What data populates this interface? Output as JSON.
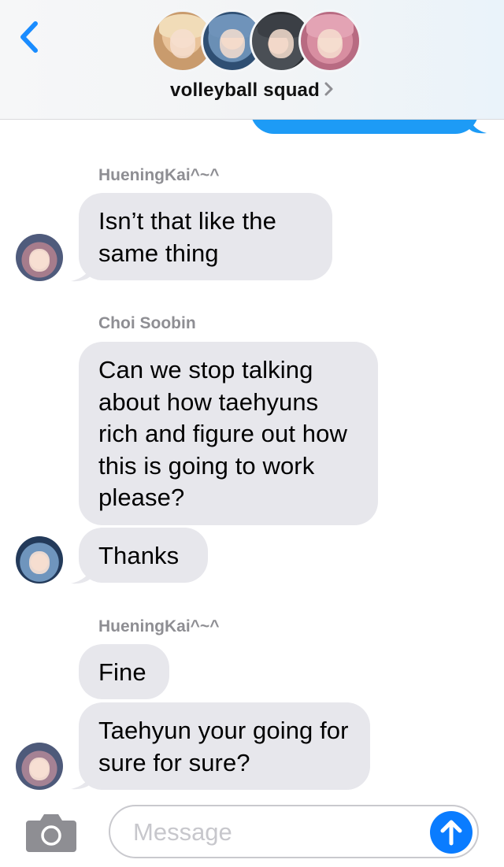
{
  "header": {
    "group_name": "volleyball squad",
    "members": [
      "member-1",
      "member-2",
      "member-3",
      "member-4"
    ]
  },
  "messages": [
    {
      "sender": "HueningKai^~^",
      "text": "Isn’t that like the same thing"
    },
    {
      "sender": "Choi Soobin",
      "text": "Can we stop talking about how taehyuns rich and figure out how this is going to work please?"
    },
    {
      "sender": "",
      "text": "Thanks"
    },
    {
      "sender": "HueningKai^~^",
      "text": "Fine"
    },
    {
      "sender": "",
      "text": "Taehyun your going for sure for sure?"
    }
  ],
  "composer": {
    "placeholder": "Message"
  },
  "colors": {
    "incoming_bubble": "#e7e7ec",
    "outgoing_bubble": "#1d9bf6",
    "accent": "#0a7cff",
    "sender_label": "#8e8e93"
  },
  "icons": [
    "back-chevron-icon",
    "chevron-right-icon",
    "camera-icon",
    "send-arrow-icon"
  ]
}
